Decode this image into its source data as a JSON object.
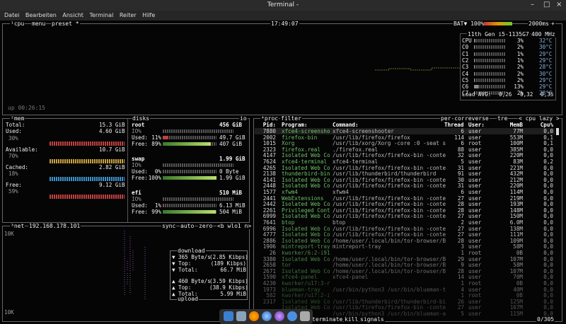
{
  "window": {
    "title": "Terminal -",
    "minimize": "–",
    "maximize": "□",
    "close": "×"
  },
  "menu": [
    "Datei",
    "Bearbeiten",
    "Ansicht",
    "Terminal",
    "Reiter",
    "Hilfe"
  ],
  "cpu": {
    "label": "cpu",
    "menu": "menu",
    "preset": "preset *",
    "time": "17:49:07",
    "bat_label": "BAT▼ 100%",
    "interval": "2000ms",
    "plus": "+",
    "uptime": "up 00:26:15",
    "model": "11th Gen i5-1135G7",
    "freq": "400 MHz",
    "cores": [
      {
        "name": "CPU",
        "pct": "3%",
        "temp": "32°C",
        "fill": 0.05
      },
      {
        "name": "C0",
        "pct": "2%",
        "temp": "30°C",
        "fill": 0.03
      },
      {
        "name": "C1",
        "pct": "1%",
        "temp": "29°C",
        "fill": 0.02
      },
      {
        "name": "C2",
        "pct": "1%",
        "temp": "29°C",
        "fill": 0.02
      },
      {
        "name": "C3",
        "pct": "2%",
        "temp": "28°C",
        "fill": 0.03
      },
      {
        "name": "C4",
        "pct": "2%",
        "temp": "30°C",
        "fill": 0.03
      },
      {
        "name": "C5",
        "pct": "2%",
        "temp": "29°C",
        "fill": 0.03
      },
      {
        "name": "C6",
        "pct": "13%",
        "temp": "29°C",
        "fill": 0.13
      },
      {
        "name": "C7",
        "pct": "2%",
        "temp": "28°C",
        "fill": 0.03
      }
    ],
    "load_label": "Load AVG:",
    "load": [
      "0,26",
      "0,32",
      "0,35"
    ]
  },
  "mem": {
    "label": "mem",
    "total_label": "Total:",
    "total": "15.3 GiB",
    "used_label": "Used:",
    "used": "4.60 GiB",
    "used_pct": "30%",
    "available_label": "Available:",
    "available": "10.7 GiB",
    "available_pct": "70%",
    "cached_label": "Cached:",
    "cached": "2.82 GiB",
    "cached_pct": "18%",
    "free_label": "Free:",
    "free": "9.12 GiB",
    "free_pct": "59%"
  },
  "disks": {
    "label": "disks",
    "io_tag": "io",
    "entries": [
      {
        "name": "root",
        "size": "456 GiB",
        "io": "IO%",
        "used_label": "Used:",
        "used_pct": "11%",
        "used": "49.7 GiB",
        "free_label": "Free:",
        "free_pct": "89%",
        "free": "407 GiB",
        "used_fill": 0.11,
        "free_fill": 0.89
      },
      {
        "name": "swap",
        "size": "1.99 GiB",
        "io": "IO%",
        "used_label": "Used:",
        "used_pct": "0%",
        "used": "0 Byte",
        "free_label": "Free:",
        "free_pct": "100%",
        "free": "1.99 GiB",
        "used_fill": 0.0,
        "free_fill": 1.0
      },
      {
        "name": "efi",
        "size": "510 MiB",
        "io": "IO%",
        "used_label": "Used:",
        "used_pct": "1%",
        "used": "6.13 MiB",
        "free_label": "Free:",
        "free_pct": "99%",
        "free": "504 MiB",
        "used_fill": 0.01,
        "free_fill": 0.99
      }
    ]
  },
  "net": {
    "label": "net",
    "ip": "192.168.178.101",
    "sync": "sync",
    "auto": "auto",
    "zero": "zero",
    "iface": "<b wlo1 n>",
    "scale_top": "10K",
    "scale_bottom": "10K",
    "download_title": "download",
    "download": [
      {
        "icon": "▼",
        "label": "",
        "value": "365 Byte/s",
        "sub": "(2.85 Kibps)"
      },
      {
        "icon": "▼",
        "label": "Top:",
        "value": "",
        "sub": "(189 Kibps)"
      },
      {
        "icon": "▼",
        "label": "Total:",
        "value": "",
        "sub": "66.7 MiB"
      }
    ],
    "upload_title": "upload",
    "upload": [
      {
        "icon": "▲",
        "label": "",
        "value": "460 Byte/s",
        "sub": "(3.59 Kibps)"
      },
      {
        "icon": "▲",
        "label": "Top:",
        "value": "",
        "sub": "(38.9 Kibps)"
      },
      {
        "icon": "▲",
        "label": "Total:",
        "value": "",
        "sub": "5.99 MiB"
      }
    ]
  },
  "proc": {
    "label": "proc",
    "filter": "filter",
    "percore": "per-core",
    "reverse": "reverse",
    "tree": "tre",
    "sort": "< cpu lazy >",
    "count": "0/305",
    "headers": [
      "Pid:",
      "Program:",
      "Command:",
      "Threads:",
      "User:",
      "MemB",
      "Cpu%"
    ],
    "rows": [
      [
        "7880",
        "xfce4-screensho",
        "xfce4-screenshooter",
        "6",
        "user",
        "77M",
        "0,0"
      ],
      [
        "2002",
        "firefox-bin",
        "/usr/lib/firefox/firefox",
        "114",
        "user",
        "553M",
        "0,1"
      ],
      [
        "1015",
        "Xorg",
        "/usr/lib/xorg/Xorg -core :0 -seat seat0",
        "6",
        "root",
        "100M",
        "0,1"
      ],
      [
        "2323",
        "firefox.real",
        "./firefox.real",
        "88",
        "user",
        "385M",
        "0,0"
      ],
      [
        "4147",
        "Isolated Web Co",
        "/usr/lib/firefox/firefox-bin -contentpro",
        "32",
        "user",
        "220M",
        "0,0"
      ],
      [
        "7624",
        "xfce4-terminal",
        "xfce4-terminal",
        "5",
        "user",
        "83M",
        "0,2"
      ],
      [
        "4265",
        "Isolated Web Co",
        "/usr/lib/firefox/firefox-bin -contentpro",
        "31",
        "user",
        "221M",
        "0,0"
      ],
      [
        "2138",
        "thunderbird-bin",
        "/usr/lib/thunderbird/thunderbird",
        "91",
        "user",
        "432M",
        "0,0"
      ],
      [
        "4141",
        "Isolated Web Co",
        "/usr/lib/firefox/firefox-bin -contentpro",
        "30",
        "user",
        "212M",
        "0,0"
      ],
      [
        "2448",
        "Isolated Web Co",
        "/usr/lib/firefox/firefox-bin -contentpro",
        "31",
        "user",
        "220M",
        "0,0"
      ],
      [
        "1577",
        "xfwm4",
        "xfwm4",
        "6",
        "user",
        "114M",
        "0,0"
      ],
      [
        "2441",
        "WebExtensions",
        "/usr/lib/firefox/firefox-bin -contentpro",
        "27",
        "user",
        "219M",
        "0,0"
      ],
      [
        "2442",
        "Isolated Web Co",
        "/usr/lib/firefox/firefox-bin -contentpro",
        "28",
        "user",
        "193M",
        "0,0"
      ],
      [
        "2261",
        "Privileged Cont",
        "/usr/lib/firefox/firefox-bin -contentpro",
        "28",
        "user",
        "148M",
        "0,0"
      ],
      [
        "6999",
        "Isolated Web Co",
        "/usr/lib/firefox/firefox-bin -contentpro",
        "27",
        "user",
        "150M",
        "0,0"
      ],
      [
        "7641",
        "btop",
        "btop",
        "2",
        "user",
        "6.0M",
        "0,0"
      ],
      [
        "6996",
        "Isolated Web Co",
        "/usr/lib/firefox/firefox-bin -contentpro",
        "27",
        "user",
        "138M",
        "0,0"
      ],
      [
        "4777",
        "Isolated Web Co",
        "/usr/lib/firefox/firefox-bin -contentpro",
        "27",
        "user",
        "111M",
        "0,0"
      ],
      [
        "2886",
        "Isolated Web Co",
        "/home/user/.local/bin/tor-browser/Browse",
        "28",
        "user",
        "109M",
        "0,0"
      ],
      [
        "1906",
        "mintreport-tray",
        "mintreport-tray",
        "3",
        "user",
        "58M",
        "0,0"
      ],
      [
        "26",
        "kworker/6:2-i915",
        "",
        "1",
        "root",
        "0B",
        "0,0"
      ],
      [
        "3380",
        "Isolated Web Co",
        "/home/user/.local/bin/tor-browser/Browse",
        "29",
        "user",
        "107M",
        "0,0"
      ],
      [
        "2658",
        "tor",
        "/home/user/.local/bin/tor-browser/Browse",
        "9",
        "user",
        "58M",
        "0,0"
      ],
      [
        "2671",
        "Isolated Web Co",
        "/home/user/.local/bin/tor-browser/Browse",
        "28",
        "user",
        "107M",
        "0,0"
      ],
      [
        "1590",
        "xfce4-panel",
        "xfce4-panel",
        "14",
        "user",
        "70M",
        "0,0"
      ],
      [
        "4230",
        "kworker/u17:3-rb",
        "",
        "1",
        "root",
        "0B",
        "0,0"
      ],
      [
        "1973",
        "blueman-tray",
        "/usr/bin/python3 /usr/bin/blueman-tray",
        "4",
        "user",
        "40M",
        "0,0"
      ],
      [
        "582",
        "kworker/u17:2-i0",
        "",
        "1",
        "root",
        "0B",
        "0,0"
      ],
      [
        "2317",
        "Isolated Web Co",
        "/usr/lib/thunderbird/thunderbird-bin -co",
        "26",
        "user",
        "125M",
        "0,0"
      ],
      [
        "",
        "Isolated Web Co",
        "/usr/lib/firefox/firefox-bin -contentpro",
        "27",
        "user",
        "107M",
        "0,0"
      ],
      [
        "",
        "applet",
        "/usr/bin/python3 /usr/bin/blueman-applet",
        "5",
        "user",
        "115M",
        "0,0"
      ]
    ],
    "bottom": {
      "terminate": "terminate",
      "kill": "kill",
      "signals": "signals"
    }
  },
  "dock": [
    "files-icon",
    "folder-icon",
    "firefox-icon",
    "thunderbird-icon",
    "tor-icon",
    "network-icon",
    "trash-icon"
  ]
}
